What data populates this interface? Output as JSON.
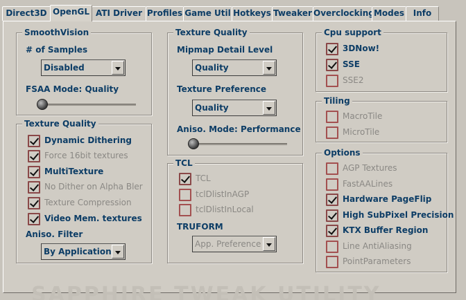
{
  "tabs": [
    "Direct3D",
    "OpenGL",
    "ATI Driver",
    "Profiles",
    "Game Util",
    "Hotkeys",
    "Tweaker",
    "Overclocking",
    "Modes",
    "Info"
  ],
  "active_tab": "OpenGL",
  "watermark": "SAPPHIRE TWEAK UTILITY",
  "smoothvision": {
    "title": "SmoothVision",
    "samples_label": "# of Samples",
    "samples_value": "Disabled",
    "fsaa_label": "FSAA Mode: Quality",
    "fsaa_level": 0
  },
  "texture_left": {
    "title": "Texture Quality",
    "items": [
      {
        "label": "Dynamic Dithering",
        "checked": true,
        "enabled": true
      },
      {
        "label": "Force 16bit textures",
        "checked": true,
        "enabled": false
      },
      {
        "label": "MultiTexture",
        "checked": true,
        "enabled": true
      },
      {
        "label": "No Dither on Alpha Bler",
        "checked": true,
        "enabled": false
      },
      {
        "label": "Texture Compression",
        "checked": true,
        "enabled": false
      },
      {
        "label": "Video Mem. textures",
        "checked": true,
        "enabled": true
      }
    ],
    "aniso_label": "Aniso. Filter",
    "aniso_value": "By Application"
  },
  "texture_mid": {
    "title": "Texture Quality",
    "mipmap_label": "Mipmap Detail Level",
    "mipmap_value": "Quality",
    "pref_label": "Texture Preference",
    "pref_value": "Quality",
    "aniso_label": "Aniso. Mode: Performance",
    "aniso_level": 0
  },
  "tcl": {
    "title": "TCL",
    "items": [
      {
        "label": "TCL",
        "checked": true,
        "enabled": false
      },
      {
        "label": "tclDlistInAGP",
        "checked": false,
        "enabled": false
      },
      {
        "label": "tclDlistInLocal",
        "checked": false,
        "enabled": false
      }
    ],
    "truform_label": "TRUFORM",
    "truform_value": "App. Preference"
  },
  "cpu": {
    "title": "Cpu support",
    "items": [
      {
        "label": "3DNow!",
        "checked": true,
        "enabled": true
      },
      {
        "label": "SSE",
        "checked": true,
        "enabled": true
      },
      {
        "label": "SSE2",
        "checked": false,
        "enabled": false
      }
    ]
  },
  "tiling": {
    "title": "Tiling",
    "items": [
      {
        "label": "MacroTile",
        "checked": false,
        "enabled": false
      },
      {
        "label": "MicroTile",
        "checked": false,
        "enabled": false
      }
    ]
  },
  "options": {
    "title": "Options",
    "items": [
      {
        "label": "AGP Textures",
        "checked": false,
        "enabled": false
      },
      {
        "label": "FastAALines",
        "checked": false,
        "enabled": false
      },
      {
        "label": "Hardware PageFlip",
        "checked": true,
        "enabled": true
      },
      {
        "label": "High SubPixel Precision",
        "checked": true,
        "enabled": true
      },
      {
        "label": "KTX Buffer Region",
        "checked": true,
        "enabled": true
      },
      {
        "label": "Line AntiAliasing",
        "checked": false,
        "enabled": false
      },
      {
        "label": "PointParameters",
        "checked": false,
        "enabled": false
      }
    ]
  }
}
